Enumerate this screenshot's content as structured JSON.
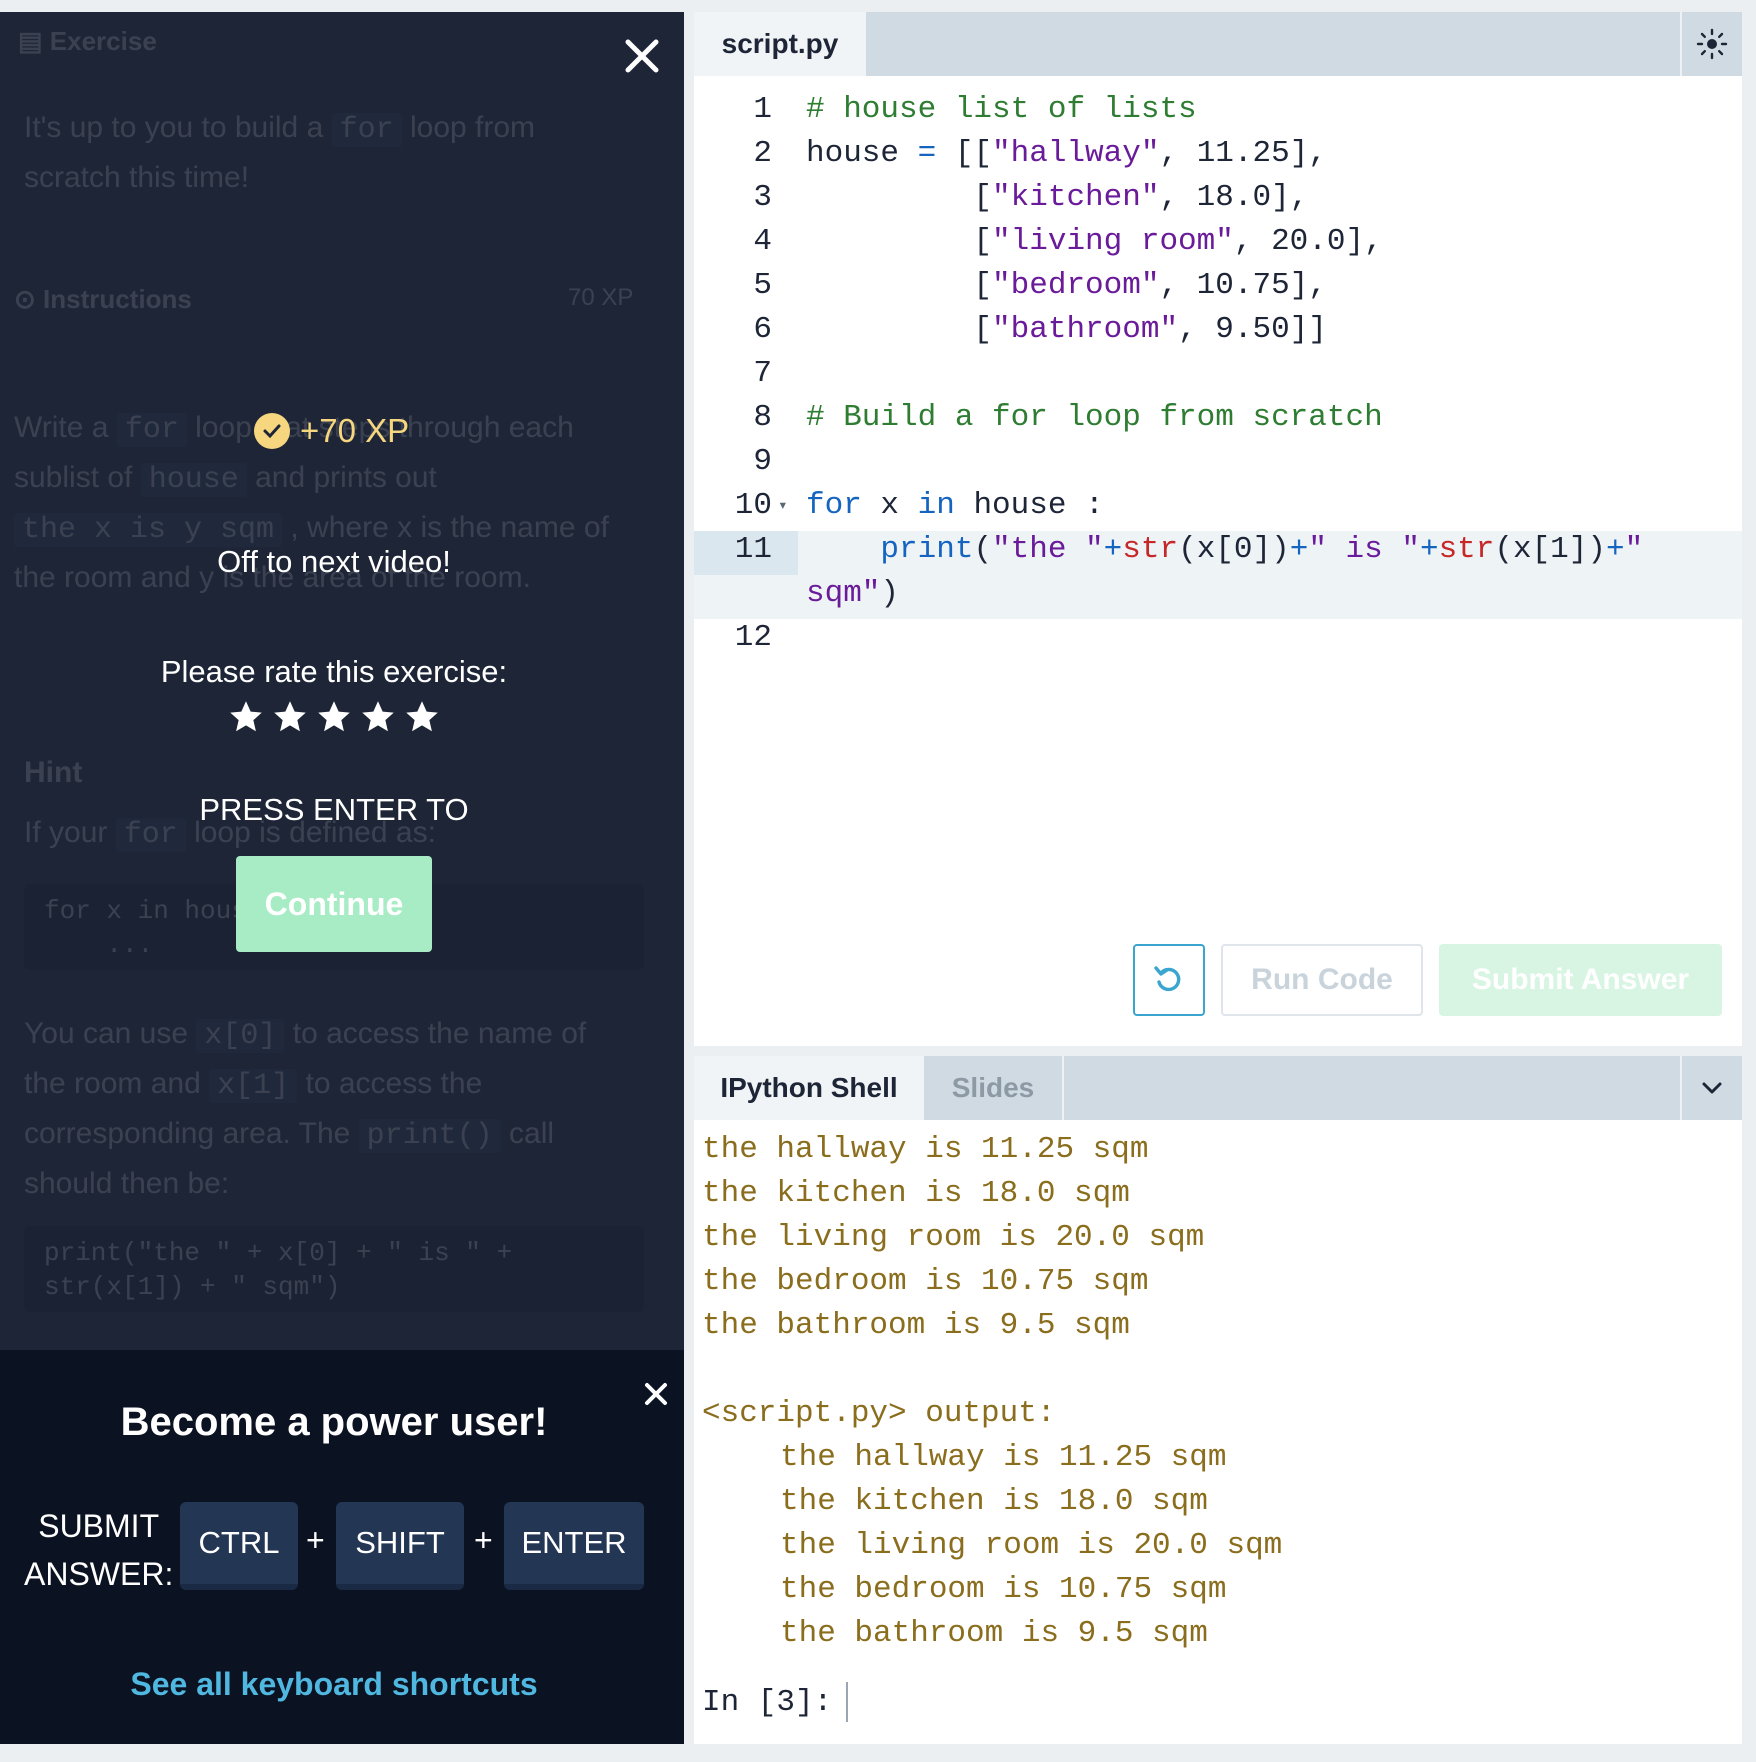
{
  "background_panel": {
    "exercise_heading": "Exercise",
    "intro_prefix": "It's up to you to build a",
    "intro_code": "for",
    "intro_suffix": "loop from",
    "intro_line2": "scratch this time!",
    "instructions_heading": "Instructions",
    "xp_badge": "70 XP",
    "instr_l1_prefix": "Write a",
    "instr_l1_code": "for",
    "instr_l1_suffix": "loop that steps through each",
    "instr_l2_prefix": "sublist of",
    "instr_l2_code": "house",
    "instr_l2_suffix": "and prints out",
    "instr_l3_code": "the x is y sqm",
    "instr_l3_suffix": ", where x is the name of",
    "instr_l4": "the room and y is the area of the room.",
    "hint_heading": "Hint",
    "hint_l1_prefix": "If your",
    "hint_l1_code": "for",
    "hint_l1_suffix": "loop is defined as:",
    "hint_code_block_l1": "for x in house :",
    "hint_code_block_l2": "    ...",
    "hint_l2_prefix": "You can use",
    "hint_l2_code": "x[0]",
    "hint_l2_suffix": "to access the name of",
    "hint_l3_prefix": "the room and",
    "hint_l3_code": "x[1]",
    "hint_l3_suffix": "to access the",
    "hint_l4_prefix": "corresponding area. The",
    "hint_l4_code": "print()",
    "hint_l4_suffix": "call",
    "hint_l5": "should then be:",
    "hint_code2_l1": "print(\"the \" + x[0] + \" is \" +",
    "hint_code2_l2": "str(x[1]) + \" sqm\")"
  },
  "modal": {
    "close_icon": "close-icon",
    "xp_gained": "+70 XP",
    "next_text": "Off to next video!",
    "rate_prompt": "Please rate this exercise:",
    "stars": [
      "1",
      "2",
      "3",
      "4",
      "5"
    ],
    "press_enter": "PRESS ENTER TO",
    "continue_label": "Continue"
  },
  "power_user": {
    "title": "Become a power user!",
    "submit_label_l1": "SUBMIT",
    "submit_label_l2": "ANSWER:",
    "keys": [
      "CTRL",
      "SHIFT",
      "ENTER"
    ],
    "plus": "+",
    "shortcuts_link": "See all keyboard shortcuts"
  },
  "editor": {
    "tab_name": "script.py",
    "theme_icon": "sun-icon",
    "line_numbers": [
      "1",
      "2",
      "3",
      "4",
      "5",
      "6",
      "7",
      "8",
      "9",
      "10",
      "11",
      "12"
    ],
    "run_label": "Run Code",
    "submit_label": "Submit Answer"
  },
  "shell": {
    "tab_ipython": "IPython Shell",
    "tab_slides": "Slides",
    "output_lines": [
      "the hallway is 11.25 sqm",
      "the kitchen is 18.0 sqm",
      "the living room is 20.0 sqm",
      "the bedroom is 10.75 sqm",
      "the bathroom is 9.5 sqm",
      "",
      "<script.py> output:"
    ],
    "script_output_lines": [
      "the hallway is 11.25 sqm",
      "the kitchen is 18.0 sqm",
      "the living room is 20.0 sqm",
      "the bedroom is 10.75 sqm",
      "the bathroom is 9.5 sqm"
    ],
    "prompt": "In [3]:"
  },
  "colors": {
    "left_bg": "#1d2537",
    "xp_gold": "#f6d67e",
    "continue_green": "#a8ecc6",
    "link_blue": "#4fb7e0",
    "shell_output": "#8a6d1d"
  }
}
